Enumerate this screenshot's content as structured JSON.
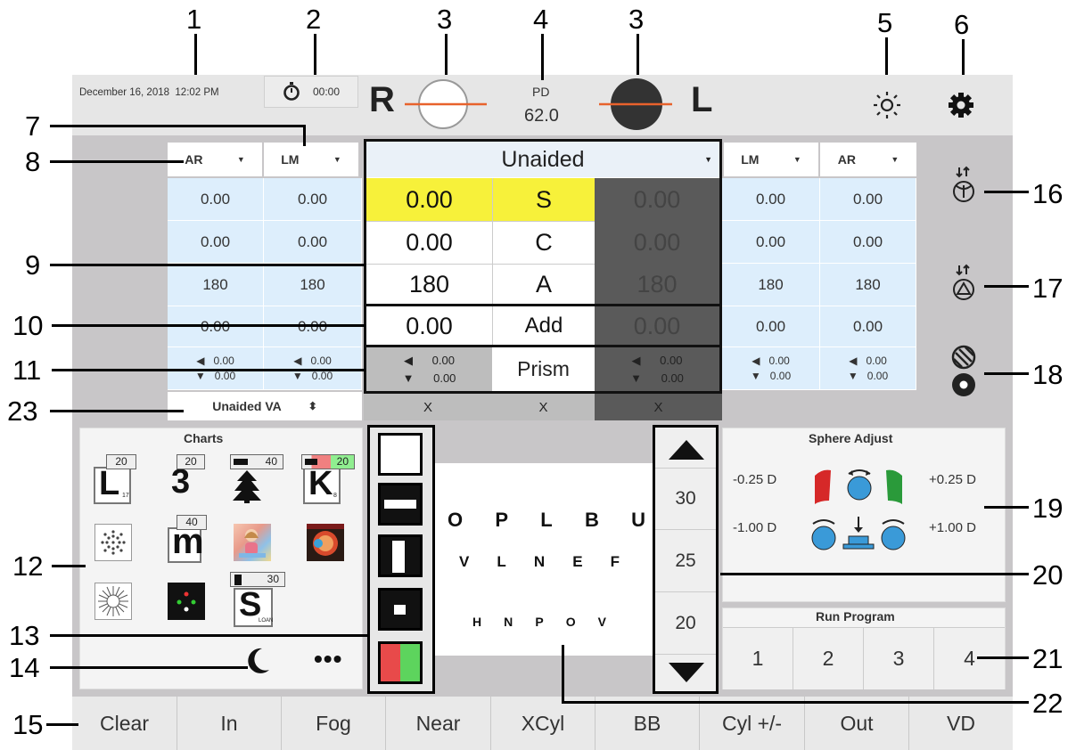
{
  "callouts": {
    "c1": "1",
    "c2": "2",
    "c3a": "3",
    "c4": "4",
    "c3b": "3",
    "c5": "5",
    "c6": "6",
    "c7": "7",
    "c8": "8",
    "c9": "9",
    "c10": "10",
    "c11": "11",
    "c23": "23",
    "c12": "12",
    "c13": "13",
    "c14": "14",
    "c15": "15",
    "c16": "16",
    "c17": "17",
    "c18": "18",
    "c19": "19",
    "c20": "20",
    "c21": "21",
    "c22": "22"
  },
  "header": {
    "datetime": "December 16, 2018  12:02 PM",
    "timer": "00:00",
    "right_eye": "R",
    "left_eye": "L",
    "pd_label": "PD",
    "pd_value": "62.0"
  },
  "left_table": {
    "col1_header": "AR",
    "col2_header": "LM",
    "col1": [
      "0.00",
      "0.00",
      "180",
      "0.00"
    ],
    "col2": [
      "0.00",
      "0.00",
      "180",
      "0.00"
    ],
    "prism_col1": [
      "0.00",
      "0.00"
    ],
    "prism_col2": [
      "0.00",
      "0.00"
    ],
    "va_selector": "Unaided VA"
  },
  "center_table": {
    "mode": "Unaided",
    "rows": [
      {
        "right": "0.00",
        "label": "S",
        "left": "0.00"
      },
      {
        "right": "0.00",
        "label": "C",
        "left": "0.00"
      },
      {
        "right": "180",
        "label": "A",
        "left": "180"
      },
      {
        "right": "0.00",
        "label": "Add",
        "left": "0.00"
      }
    ],
    "prism_label": "Prism",
    "prism_right": [
      "0.00",
      "0.00"
    ],
    "prism_left": [
      "0.00",
      "0.00"
    ],
    "va_row": [
      "X",
      "X",
      "X"
    ]
  },
  "right_table": {
    "col1_header": "LM",
    "col2_header": "AR",
    "col1": [
      "0.00",
      "0.00",
      "180",
      "0.00"
    ],
    "col2": [
      "0.00",
      "0.00",
      "180",
      "0.00"
    ],
    "prism_col1": [
      "0.00",
      "0.00"
    ],
    "prism_col2": [
      "0.00",
      "0.00"
    ]
  },
  "charts": {
    "title": "Charts",
    "tag_20a": "20",
    "tag_20b": "20",
    "tag_40a": "40",
    "tag_20c": "20",
    "tag_40b": "40",
    "tag_30": "30",
    "L_letter": "L",
    "L_sub": "17",
    "three": "3",
    "K_letter": "K",
    "K_sub": "8",
    "m_letter": "m",
    "S_letter": "S",
    "S_sub": "LOAN"
  },
  "eye_chart": {
    "row1": [
      "O",
      "P",
      "L",
      "B",
      "U"
    ],
    "row2": [
      "V",
      "L",
      "N",
      "E",
      "F"
    ],
    "row3": [
      "H",
      "N",
      "P",
      "O",
      "V"
    ],
    "sizes": [
      "30",
      "25",
      "20"
    ]
  },
  "sphere_adjust": {
    "title": "Sphere Adjust",
    "minus_small": "-0.25 D",
    "plus_small": "+0.25 D",
    "minus_big": "-1.00 D",
    "plus_big": "+1.00 D"
  },
  "run_program": {
    "title": "Run Program",
    "buttons": [
      "1",
      "2",
      "3",
      "4"
    ]
  },
  "bottom_bar": [
    "Clear",
    "In",
    "Fog",
    "Near",
    "XCyl",
    "BB",
    "Cyl +/-",
    "Out",
    "VD"
  ],
  "colors": {
    "highlight_yellow": "#f7f13a",
    "cell_blue": "#ddeefc",
    "dark_cell": "#5a5a5a",
    "lens_line": "#e8622c"
  }
}
